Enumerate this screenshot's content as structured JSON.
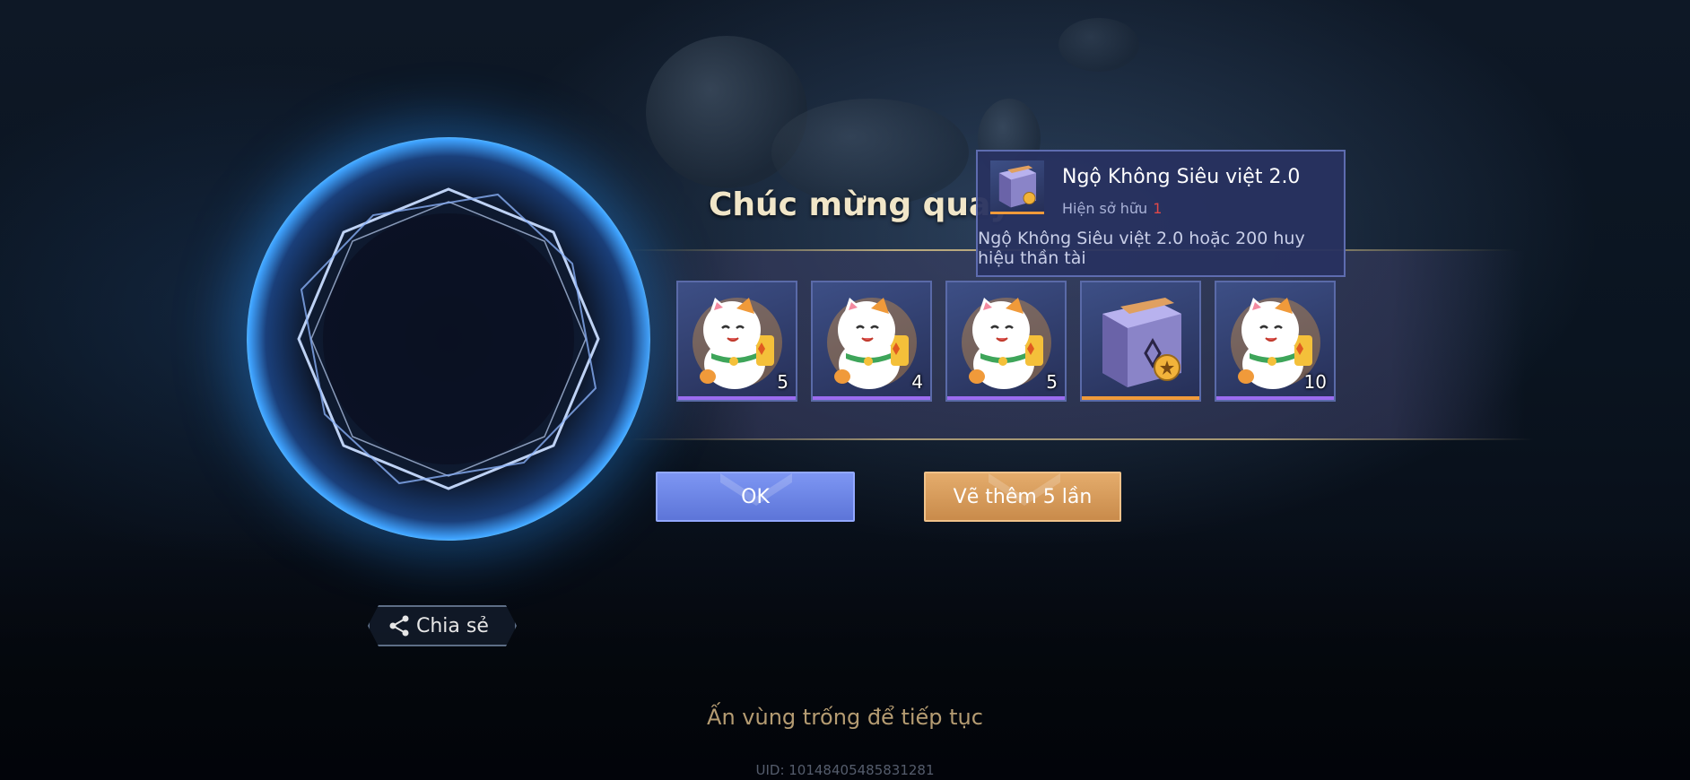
{
  "title": "Chúc mừng quay",
  "rewards": [
    {
      "icon": "lucky-cat-icon",
      "count": "5"
    },
    {
      "icon": "lucky-cat-icon",
      "count": "4"
    },
    {
      "icon": "lucky-cat-icon",
      "count": "5"
    },
    {
      "icon": "skin-box-icon",
      "count": ""
    },
    {
      "icon": "lucky-cat-icon",
      "count": "10"
    }
  ],
  "buttons": {
    "ok": "OK",
    "draw_more": "Vẽ thêm 5 lần"
  },
  "share_label": "Chia sẻ",
  "hint": "Ấn vùng trống để tiếp tục",
  "uid": "UID: 10148405485831281",
  "tooltip": {
    "item_name": "Ngộ Không Siêu việt 2.0",
    "owned_label": "Hiện sở hữu",
    "owned_count": "1",
    "description": "Ngộ Không Siêu việt 2.0 hoặc 200 huy hiệu thần tài"
  },
  "colors": {
    "ok_button": "#6d86e6",
    "draw_more_button": "#d69b5b",
    "rarity_purple": "#9b6cf0",
    "rarity_gold": "#f09a3a",
    "owned_count": "#e04848"
  }
}
